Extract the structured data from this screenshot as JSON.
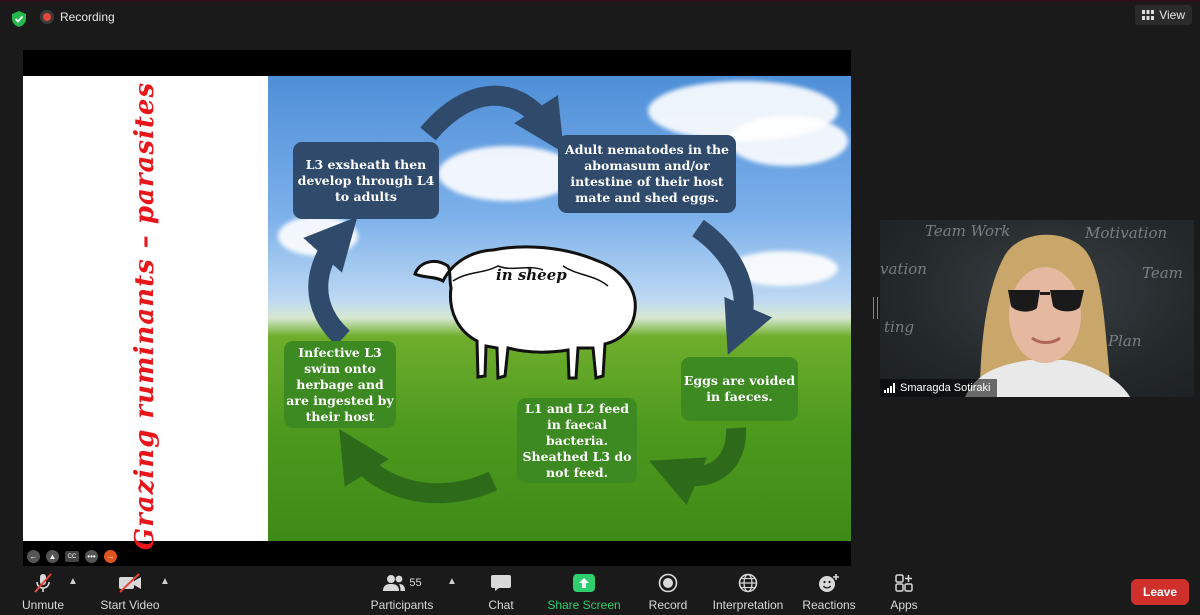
{
  "top_bar": {
    "recording_label": "Recording",
    "view_label": "View"
  },
  "slide": {
    "vertical_title": "Grazing ruminants – parasites",
    "sheep_label": "in sheep",
    "boxes": {
      "l3_develop": "L3 exsheath then develop through L4 to adults",
      "adult_nematodes": "Adult nematodes in the abomasum and/or intestine of their host mate and shed eggs.",
      "infective_l3": "Infective L3 swim onto herbage and are ingested by their host",
      "eggs_voided": "Eggs are voided in faeces.",
      "l1_l2": "L1 and L2 feed in faecal bacteria. Sheathed L3 do not feed."
    },
    "colors": {
      "blue_box": "#2f4a6b",
      "green_box": "#3d8a22",
      "title_red": "#e8161b"
    }
  },
  "video": {
    "participant_name": "Smaragda Sotiraki",
    "chalk_words": [
      "Team Work",
      "Motivation",
      "vation",
      "Team",
      "ting",
      "Plan"
    ]
  },
  "toolbar": {
    "unmute": "Unmute",
    "start_video": "Start Video",
    "participants": "Participants",
    "participants_count": "55",
    "chat": "Chat",
    "share_screen": "Share Screen",
    "record": "Record",
    "interpretation": "Interpretation",
    "reactions": "Reactions",
    "apps": "Apps",
    "leave": "Leave",
    "accent_share": "#2fcf6e",
    "accent_leave": "#d0302c"
  }
}
